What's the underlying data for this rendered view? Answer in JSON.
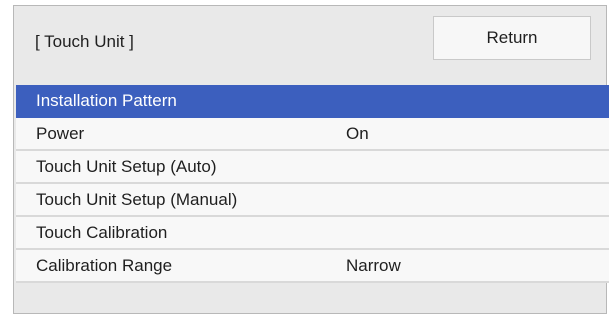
{
  "header": {
    "title": "[ Touch Unit ]",
    "return_label": "Return"
  },
  "menu": {
    "items": [
      {
        "label": "Installation Pattern",
        "value": "",
        "selected": true
      },
      {
        "label": "Power",
        "value": "On",
        "selected": false
      },
      {
        "label": "Touch Unit Setup (Auto)",
        "value": "",
        "selected": false
      },
      {
        "label": "Touch Unit Setup (Manual)",
        "value": "",
        "selected": false
      },
      {
        "label": "Touch Calibration",
        "value": "",
        "selected": false
      },
      {
        "label": "Calibration Range",
        "value": "Narrow",
        "selected": false
      }
    ]
  },
  "colors": {
    "selection": "#3c5fbe",
    "panel_background": "#e9e9e9",
    "row_background": "#f8f8f8"
  }
}
